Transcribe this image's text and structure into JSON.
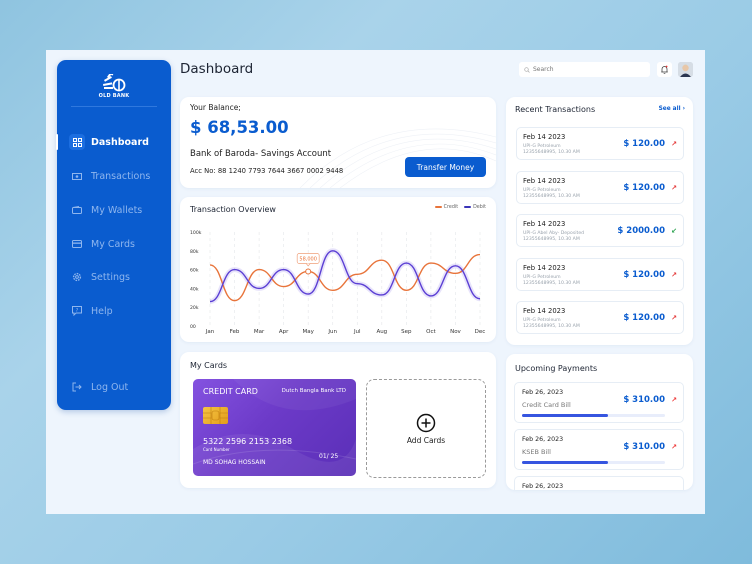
{
  "app": {
    "brand": "OLD BANK",
    "page_title": "Dashboard"
  },
  "sidebar": {
    "items": [
      {
        "label": "Dashboard",
        "icon": "grid-icon",
        "active": true
      },
      {
        "label": "Transactions",
        "icon": "cash-icon"
      },
      {
        "label": "My Wallets",
        "icon": "wallet-icon"
      },
      {
        "label": "My Cards",
        "icon": "card-icon"
      },
      {
        "label": "Settings",
        "icon": "gear-icon"
      },
      {
        "label": "Help",
        "icon": "help-icon"
      }
    ],
    "logout": "Log Out"
  },
  "header": {
    "search_placeholder": "Search"
  },
  "balance": {
    "label": "Your Balance;",
    "amount": "$ 68,53.00",
    "bank": "Bank of Baroda- Savings Account",
    "account": "Acc No: 88 1240 7793 7644 3667 0002 9448",
    "transfer_label": "Transfer Money"
  },
  "overview": {
    "title": "Transaction Overview",
    "tooltip": "58,000"
  },
  "chart_data": {
    "type": "line",
    "title": "Transaction Overview",
    "categories": [
      "Jan",
      "Feb",
      "Mar",
      "Apr",
      "May",
      "Jun",
      "Jul",
      "Aug",
      "Sep",
      "Oct",
      "Nov",
      "Dec"
    ],
    "y_ticks": [
      "00",
      "20k",
      "40k",
      "60k",
      "80k",
      "100k"
    ],
    "ylim": [
      0,
      100000
    ],
    "legend": "top-right",
    "series": [
      {
        "name": "Credit",
        "color": "#e8743b",
        "values": [
          65000,
          27000,
          60000,
          42000,
          58000,
          38000,
          55000,
          70000,
          38000,
          67000,
          56000,
          76000
        ]
      },
      {
        "name": "Debit",
        "color": "#5b3fd4",
        "values": [
          26000,
          60000,
          40000,
          60000,
          34000,
          80000,
          45000,
          33000,
          67000,
          32000,
          64000,
          29000
        ]
      }
    ],
    "annotation": {
      "series": "Credit",
      "x": "May",
      "label": "58,000"
    }
  },
  "my_cards": {
    "title": "My Cards",
    "card": {
      "type": "CREDIT CARD",
      "bank": "Dutch Bangla Bank LTD",
      "number": "5322 2596 2153 2368",
      "number_label": "Card Number",
      "holder": "MD SOHAG HOSSAIN",
      "expiry": "01/ 25"
    },
    "add_label": "Add Cards"
  },
  "recent": {
    "title": "Recent Transactions",
    "see_all": "See all",
    "items": [
      {
        "date": "Feb 14 2023",
        "desc": "UPI-G Petroleum",
        "ref": "12355648995,  10.30 AM",
        "amount": "$ 120.00",
        "dir": "out"
      },
      {
        "date": "Feb 14 2023",
        "desc": "UPI-G Petroleum",
        "ref": "12355648995,  10.30 AM",
        "amount": "$ 120.00",
        "dir": "out"
      },
      {
        "date": "Feb 14 2023",
        "desc": "UPI-G Abel Aby- Deposited",
        "ref": "12355648995,  10.30 AM",
        "amount": "$ 2000.00",
        "dir": "in"
      },
      {
        "date": "Feb 14 2023",
        "desc": "UPI-G Petroleum",
        "ref": "12355648995,  10.30 AM",
        "amount": "$ 120.00",
        "dir": "out"
      },
      {
        "date": "Feb 14 2023",
        "desc": "UPI-G Petroleum",
        "ref": "12355648995,  10.30 AM",
        "amount": "$ 120.00",
        "dir": "out"
      }
    ]
  },
  "upcoming": {
    "title": "Upcoming Payments",
    "items": [
      {
        "date": "Feb 26, 2023",
        "name": "Credit Card Bill",
        "amount": "$ 310.00",
        "progress": 0.6
      },
      {
        "date": "Feb 26, 2023",
        "name": "KSEB Bill",
        "amount": "$ 310.00",
        "progress": 0.6
      },
      {
        "date": "Feb 26, 2023",
        "name": "",
        "amount": "",
        "progress": 0
      }
    ]
  },
  "colors": {
    "primary": "#0a5ccf",
    "credit": "#e8743b",
    "debit": "#5b3fd4",
    "out_arrow": "#e33333",
    "in_arrow": "#1f9d45"
  }
}
